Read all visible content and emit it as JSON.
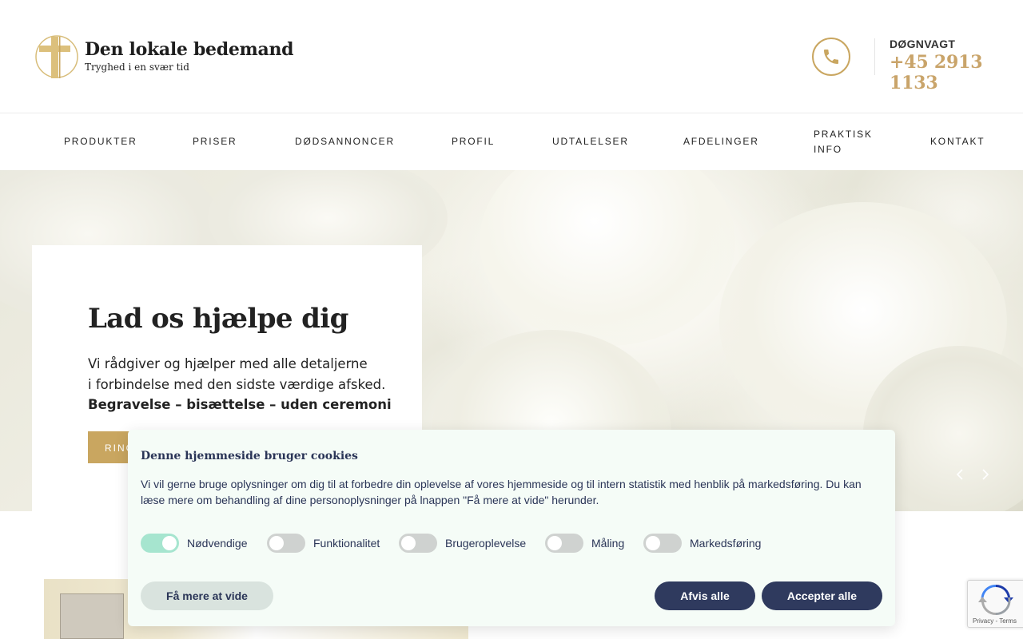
{
  "brand": {
    "name": "Den lokale bedemand",
    "tagline": "Tryghed i en svær tid",
    "gold": "#c9a660"
  },
  "hotline": {
    "label": "DØGNVAGT",
    "number": "+45 2913 1133"
  },
  "nav": {
    "items": [
      "PRODUKTER",
      "PRISER",
      "DØDSANNONCER",
      "PROFIL",
      "UDTALELSER",
      "AFDELINGER",
      "PRAKTISK",
      "KONTAKT"
    ],
    "praktisk_line2": "INFO"
  },
  "hero": {
    "title": "Lad os hjælpe dig",
    "line1": "Vi rådgiver og hjælper med alle detaljerne",
    "line2": "i forbindelse med den sidste værdige afsked.",
    "bold_line": "Begravelse – bisættelse – uden ceremoni",
    "cta_label": "RING"
  },
  "cookie": {
    "title": "Denne hjemmeside bruger cookies",
    "text": "Vi vil gerne bruge oplysninger om dig til at forbedre din oplevelse af vores hjemmeside og til intern statistik med henblik på markedsføring. Du kan læse mere om behandling af dine personoplysninger på lnappen \"Få mere at vide\" herunder.",
    "toggles": [
      {
        "label": "Nødvendige",
        "on": true
      },
      {
        "label": "Funktionalitet",
        "on": false
      },
      {
        "label": "Brugeroplevelse",
        "on": false
      },
      {
        "label": "Måling",
        "on": false
      },
      {
        "label": "Markedsføring",
        "on": false
      }
    ],
    "learn_more": "Få mere at vide",
    "reject_all": "Afvis alle",
    "accept_all": "Accepter alle",
    "toggle_on_color": "#a6e5cf",
    "button_color": "#2f3a5e"
  },
  "recaptcha": {
    "links": "Privacy - Terms"
  }
}
